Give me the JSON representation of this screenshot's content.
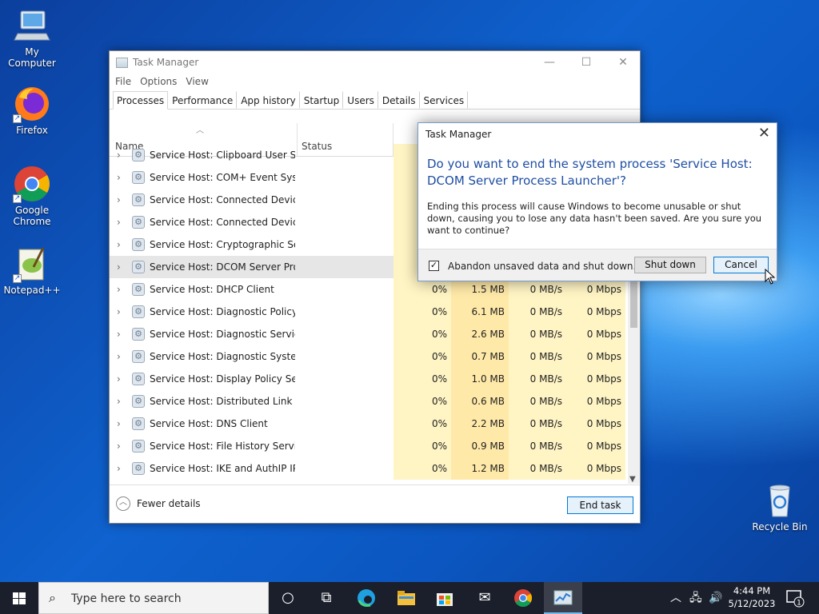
{
  "desktop": {
    "icons": [
      {
        "label": "My Computer",
        "icon": "computer-icon"
      },
      {
        "label": "Firefox",
        "icon": "firefox-icon"
      },
      {
        "label": "Google Chrome",
        "icon": "chrome-icon"
      },
      {
        "label": "Notepad++",
        "icon": "notepadpp-icon"
      },
      {
        "label": "Recycle Bin",
        "icon": "recycle-bin-icon"
      }
    ]
  },
  "task_manager": {
    "title": "Task Manager",
    "menu": [
      "File",
      "Options",
      "View"
    ],
    "tabs": [
      "Processes",
      "Performance",
      "App history",
      "Startup",
      "Users",
      "Details",
      "Services"
    ],
    "active_tab": "Processes",
    "columns": {
      "name": "Name",
      "status": "Status"
    },
    "rows": [
      {
        "name": "Service Host: Clipboard User Ser...",
        "cpu": "",
        "mem": "",
        "disk": "",
        "net": ""
      },
      {
        "name": "Service Host: COM+ Event Syste...",
        "cpu": "",
        "mem": "",
        "disk": "",
        "net": ""
      },
      {
        "name": "Service Host: Connected Device...",
        "cpu": "",
        "mem": "",
        "disk": "",
        "net": ""
      },
      {
        "name": "Service Host: Connected Device...",
        "cpu": "",
        "mem": "",
        "disk": "",
        "net": ""
      },
      {
        "name": "Service Host: Cryptographic Ser...",
        "cpu": "",
        "mem": "",
        "disk": "",
        "net": ""
      },
      {
        "name": "Service Host: DCOM Server Proc...",
        "cpu": "",
        "mem": "",
        "disk": "",
        "net": "",
        "selected": true
      },
      {
        "name": "Service Host: DHCP Client",
        "cpu": "0%",
        "mem": "1.5 MB",
        "disk": "0 MB/s",
        "net": "0 Mbps"
      },
      {
        "name": "Service Host: Diagnostic Policy ...",
        "cpu": "0%",
        "mem": "6.1 MB",
        "disk": "0 MB/s",
        "net": "0 Mbps"
      },
      {
        "name": "Service Host: Diagnostic Service...",
        "cpu": "0%",
        "mem": "2.6 MB",
        "disk": "0 MB/s",
        "net": "0 Mbps"
      },
      {
        "name": "Service Host: Diagnostic System...",
        "cpu": "0%",
        "mem": "0.7 MB",
        "disk": "0 MB/s",
        "net": "0 Mbps"
      },
      {
        "name": "Service Host: Display Policy Serv...",
        "cpu": "0%",
        "mem": "1.0 MB",
        "disk": "0 MB/s",
        "net": "0 Mbps"
      },
      {
        "name": "Service Host: Distributed Link Tr...",
        "cpu": "0%",
        "mem": "0.6 MB",
        "disk": "0 MB/s",
        "net": "0 Mbps"
      },
      {
        "name": "Service Host: DNS Client",
        "cpu": "0%",
        "mem": "2.2 MB",
        "disk": "0 MB/s",
        "net": "0 Mbps"
      },
      {
        "name": "Service Host: File History Service",
        "cpu": "0%",
        "mem": "0.9 MB",
        "disk": "0 MB/s",
        "net": "0 Mbps"
      },
      {
        "name": "Service Host: IKE and AuthIP IPs...",
        "cpu": "0%",
        "mem": "1.2 MB",
        "disk": "0 MB/s",
        "net": "0 Mbps"
      }
    ],
    "footer": {
      "fewer_details": "Fewer details",
      "end_task": "End task"
    }
  },
  "dialog": {
    "title": "Task Manager",
    "question": "Do you want to end the system process 'Service Host: DCOM Server Process Launcher'?",
    "message": "Ending this process will cause Windows to become unusable or shut down, causing you to lose any data hasn't been saved. Are you sure you want to continue?",
    "checkbox_label": "Abandon unsaved data and shut down.",
    "checkbox_checked": true,
    "shutdown_label": "Shut down",
    "cancel_label": "Cancel"
  },
  "taskbar": {
    "search_placeholder": "Type here to search",
    "time": "4:44 PM",
    "date": "5/12/2023",
    "notification_count": "1"
  }
}
